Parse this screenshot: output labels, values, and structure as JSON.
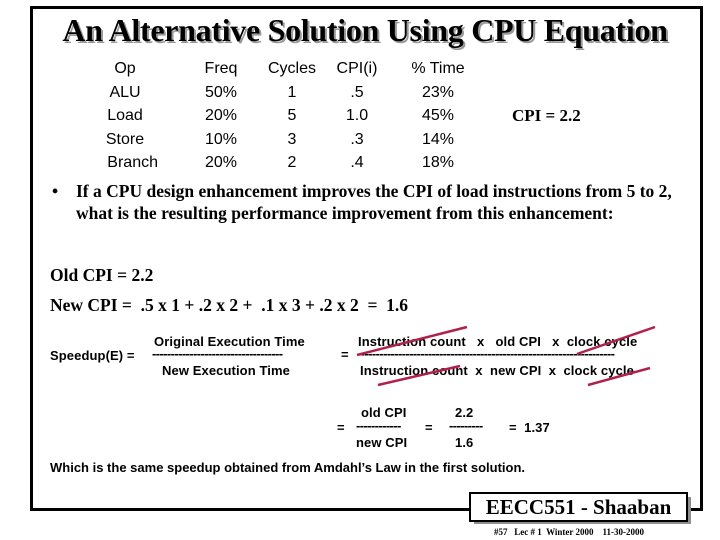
{
  "slide": {
    "title": "An Alternative Solution Using CPU Equation",
    "table": {
      "headers": [
        "Op",
        "Freq",
        "Cycles",
        "CPI(i)",
        "% Time"
      ],
      "rows": [
        {
          "op": "ALU",
          "freq": "50%",
          "cycles": "1",
          "cpi": ".5",
          "time": "23%"
        },
        {
          "op": "Load",
          "freq": "20%",
          "cycles": "5",
          "cpi": "1.0",
          "time": "45%"
        },
        {
          "op": "Store",
          "freq": "10%",
          "cycles": "3",
          "cpi": ".3",
          "time": "14%"
        },
        {
          "op": "Branch",
          "freq": "20%",
          "cycles": "2",
          "cpi": ".4",
          "time": "18%"
        }
      ]
    },
    "cpi_total": "CPI = 2.2",
    "bullet_symbol": "•",
    "bullet": "If a CPU design enhancement improves the CPI of load instructions from 5 to 2,  what is the resulting performance improvement from this enhancement:",
    "old_cpi": "Old CPI = 2.2",
    "new_cpi": "New CPI =  .5 x 1 + .2 x 2 +  .1 x 3 + .2 x 2  =  1.6",
    "speedup": {
      "label": "Speedup(E) =",
      "numerator": "Original Execution Time",
      "denominator": "New Execution Time",
      "dashes_short": "-----------------------------------",
      "eq1": "=",
      "numerator2": "Instruction count   x   old CPI   x  clock cycle",
      "dashes_long": "---------------------------------------------------------------------",
      "denominator2": "Instruction count  x  new CPI  x  clock cycle",
      "eq2": "=",
      "num3": "old CPI",
      "dashes3": "------------",
      "den3": "new CPI",
      "eq3": "=",
      "num4": "2.2",
      "dashes4": "---------",
      "den4": "1.6",
      "result": "=  1.37"
    },
    "conclusion": "Which is the same speedup obtained from Amdahl’s Law in the first solution.",
    "footer": {
      "brand": "EECC551 - Shaaban",
      "meta": "#57   Lec # 1  Winter 2000    11-30-2000"
    },
    "colors": {
      "strike": "#b0204a",
      "shadow": "#8e8e8e"
    }
  }
}
